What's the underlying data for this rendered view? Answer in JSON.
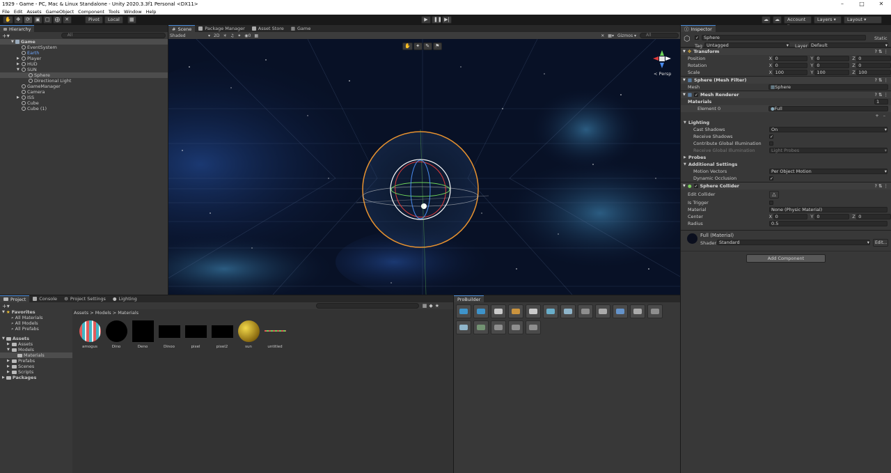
{
  "window": {
    "title": "1929 - Game - PC, Mac & Linux Standalone - Unity 2020.3.3f1 Personal <DX11>"
  },
  "menu": [
    "File",
    "Edit",
    "Assets",
    "GameObject",
    "Component",
    "Tools",
    "Window",
    "Help"
  ],
  "toolbar": {
    "pivot": "Pivot",
    "local": "Local",
    "account": "Account",
    "layers": "Layers",
    "layout": "Layout"
  },
  "hierarchy": {
    "tab": "Hierarchy",
    "search_placeholder": "All",
    "root": "Game",
    "items": [
      {
        "label": "EventSystem",
        "indent": 1
      },
      {
        "label": "Earth",
        "indent": 1
      },
      {
        "label": "Player",
        "indent": 1
      },
      {
        "label": "HUD",
        "indent": 1
      },
      {
        "label": "SUN",
        "indent": 1
      },
      {
        "label": "Sphere",
        "indent": 2
      },
      {
        "label": "Directional Light",
        "indent": 2
      },
      {
        "label": "GameManager",
        "indent": 1
      },
      {
        "label": "Camera",
        "indent": 1
      },
      {
        "label": "ISS",
        "indent": 1
      },
      {
        "label": "Cube",
        "indent": 1
      },
      {
        "label": "Cube (1)",
        "indent": 1
      }
    ]
  },
  "scene": {
    "tabs": [
      "Scene",
      "Package Manager",
      "Asset Store",
      "Game"
    ],
    "shading": "Shaded",
    "mode2d": "2D",
    "gizmos": "Gizmos",
    "search_placeholder": "All",
    "persp": "< Persp"
  },
  "project": {
    "tabs": [
      "Project",
      "Console",
      "Project Settings",
      "Lighting"
    ],
    "favorites": "Favorites",
    "fav_items": [
      "All Materials",
      "All Models",
      "All Prefabs"
    ],
    "assets_root": "Assets",
    "tree": [
      {
        "label": "Assets",
        "indent": 1
      },
      {
        "label": "Models",
        "indent": 1
      },
      {
        "label": "Materials",
        "indent": 2
      },
      {
        "label": "Prefabs",
        "indent": 1
      },
      {
        "label": "Scenes",
        "indent": 1
      },
      {
        "label": "Scripts",
        "indent": 1
      }
    ],
    "packages": "Packages",
    "breadcrumb": "Assets > Models > Materials",
    "materials": [
      "amogus",
      "Dino",
      "Deno",
      "Dinoo",
      "pixel",
      "pixel2",
      "sun",
      "untitled"
    ]
  },
  "probuilder": {
    "tab": "ProBuilder"
  },
  "inspector": {
    "tab": "Inspector",
    "object_name": "Sphere",
    "static": "Static",
    "tag_label": "Tag",
    "tag": "Untagged",
    "layer_label": "Layer",
    "layer": "Default",
    "transform": {
      "title": "Transform",
      "position": {
        "label": "Position",
        "x": "0",
        "y": "0",
        "z": "0"
      },
      "rotation": {
        "label": "Rotation",
        "x": "0",
        "y": "0",
        "z": "0"
      },
      "scale": {
        "label": "Scale",
        "x": "100",
        "y": "100",
        "z": "100"
      }
    },
    "mesh_filter": {
      "title": "Sphere (Mesh Filter)",
      "mesh_label": "Mesh",
      "mesh": "Sphere"
    },
    "mesh_renderer": {
      "title": "Mesh Renderer",
      "materials": "Materials",
      "materials_count": "1",
      "element0_label": "Element 0",
      "element0": "Full",
      "lighting": "Lighting",
      "cast_shadows_label": "Cast Shadows",
      "cast_shadows": "On",
      "receive_shadows": "Receive Shadows",
      "contribute_gi": "Contribute Global Illumination",
      "receive_gi_label": "Receive Global Illumination",
      "receive_gi": "Light Probes",
      "probes": "Probes",
      "additional": "Additional Settings",
      "motion_vectors_label": "Motion Vectors",
      "motion_vectors": "Per Object Motion",
      "dynamic_occlusion": "Dynamic Occlusion"
    },
    "sphere_collider": {
      "title": "Sphere Collider",
      "edit_collider": "Edit Collider",
      "is_trigger": "Is Trigger",
      "material_label": "Material",
      "material": "None (Physic Material)",
      "center_label": "Center",
      "center": {
        "x": "0",
        "y": "0",
        "z": "0"
      },
      "radius_label": "Radius",
      "radius": "0.5"
    },
    "material": {
      "name": "Full (Material)",
      "shader_label": "Shader",
      "shader": "Standard",
      "edit": "Edit..."
    },
    "add_component": "Add Component"
  }
}
